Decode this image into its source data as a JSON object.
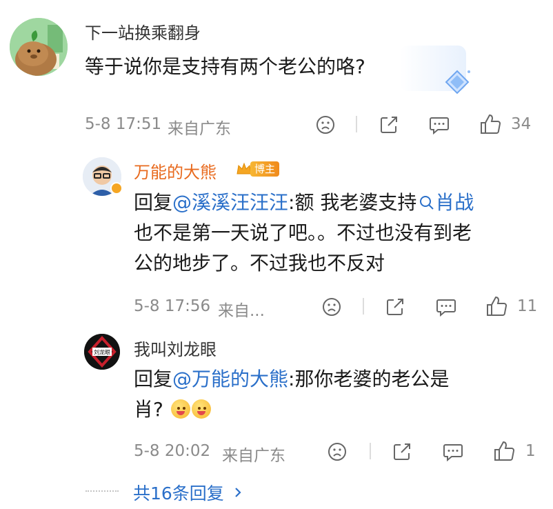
{
  "comments": [
    {
      "username": "下一站换乘翻身",
      "text": "等于说你是支持有两个老公的咯?",
      "time": "5-8 17:51",
      "location": "来自广东",
      "like_count": "34"
    },
    {
      "username": "万能的大熊",
      "badge": "博主",
      "reply_prefix": "回复",
      "mention": "@溪溪汪汪汪",
      "text_a": ":额 我老婆支持",
      "search_term": "肖战",
      "text_b": "也不是第一天说了吧。。不过也没有到老",
      "text_c": "公的地步了。不过我也不反对",
      "time": "5-8 17:56",
      "location": "来自...",
      "like_count": "11"
    },
    {
      "username": "我叫刘龙眼",
      "avatar_text": "刘龙眼",
      "reply_prefix": "回复",
      "mention": "@万能的大熊",
      "text_a": ":那你老婆的老公是",
      "text_b": "肖?",
      "time": "5-8 20:02",
      "location": "来自广东",
      "like_count": "1"
    }
  ],
  "more_replies": "共16条回复",
  "colors": {
    "link": "#2a6fc9",
    "meta": "#8a8a8a",
    "username": "#333333",
    "username_blogger": "#e86a1e"
  }
}
